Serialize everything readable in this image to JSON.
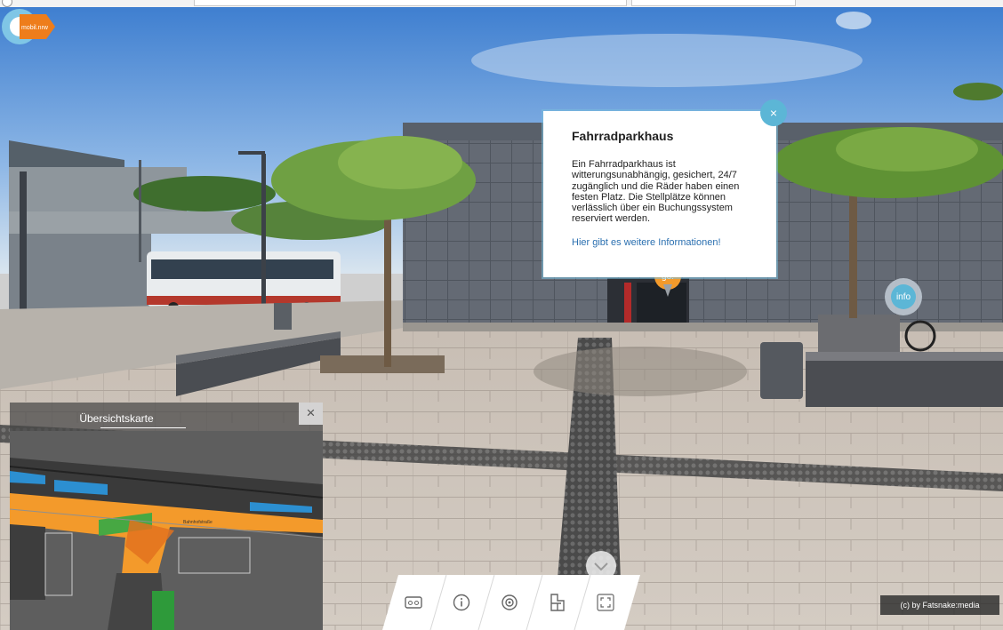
{
  "app": {
    "logo_text": "mobil.nrw"
  },
  "popup": {
    "title": "Fahrradparkhaus",
    "body": "Ein Fahrradparkhaus ist witterungsunabhängig, gesichert, 24/7 zugänglich und die Räder haben einen festen Platz. Die Stellplätze können verlässlich über ein Buchungssystem reserviert werden.",
    "link": "Hier gibt es weitere Informationen!",
    "close": "×"
  },
  "hotspots": {
    "go_label": "go!",
    "info_label": "info"
  },
  "overview_map": {
    "title": "Übersichtskarte",
    "close": "×",
    "street_label": "Bahnhofstraße"
  },
  "toolbar": {
    "items": [
      "vr-mode-icon",
      "info-icon",
      "hotspot-icon",
      "floorplan-icon",
      "fullscreen-icon"
    ],
    "expand_icon": "chevron-down-icon"
  },
  "credit": "(c) by Fatsnake:media",
  "colors": {
    "accent_blue": "#5cb6d6",
    "accent_orange": "#f39a2b",
    "link": "#2a6fb0"
  }
}
